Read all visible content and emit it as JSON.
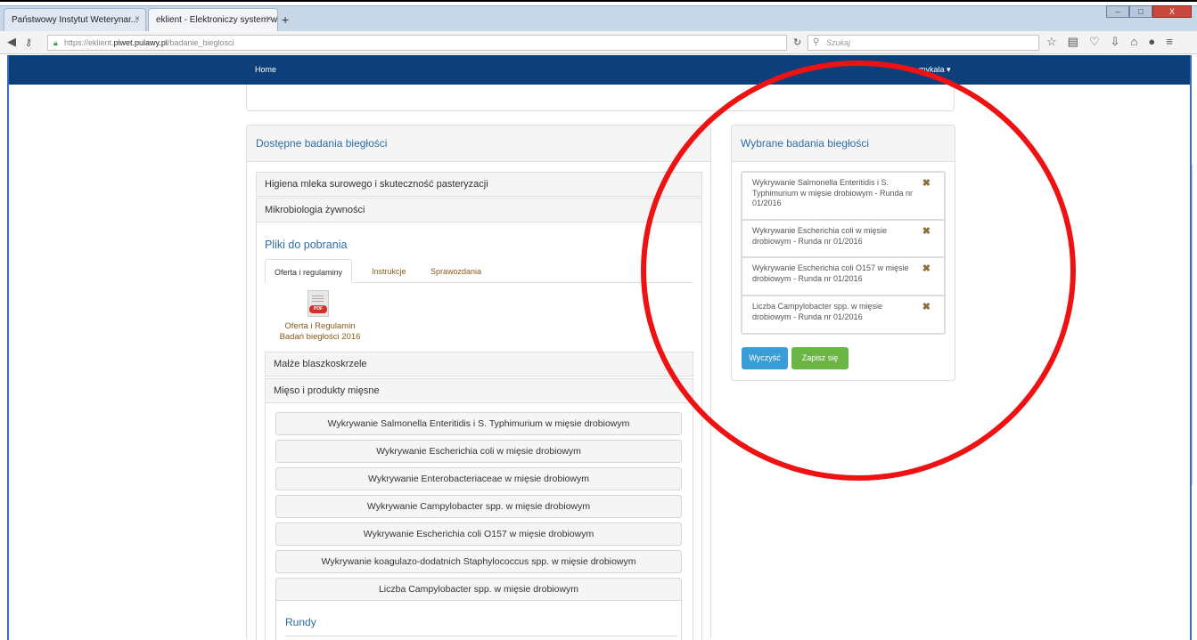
{
  "browser": {
    "tabs": [
      {
        "label": "Państwowy Instytut Weterynar..."
      },
      {
        "label": "eklient - Elektroniczy system w..."
      }
    ],
    "tab_close": "×",
    "new_tab": "+",
    "url_prefix": "https://eklient.",
    "url_domain": "piwet.pulawy.pl",
    "url_path": "/badanie_bieglosci",
    "search_placeholder": "Szukaj",
    "window_controls": {
      "minimize": "–",
      "maximize": "□",
      "close": "X"
    }
  },
  "appnav": {
    "home": "Home",
    "user": "…mykala ▾"
  },
  "left_panel": {
    "title": "Dostępne badania biegłości",
    "accordion": [
      {
        "label": "Higiena mleka surowego i skuteczność pasteryzacji"
      },
      {
        "label": "Mikrobiologia żywności"
      },
      {
        "label": "Małże blaszkoskrzele"
      },
      {
        "label": "Mięso i produkty mięsne"
      }
    ],
    "downloads_title": "Pliki do pobrania",
    "download_tabs": [
      {
        "label": "Oferta i regulaminy",
        "active": true
      },
      {
        "label": "Instrukcje"
      },
      {
        "label": "Sprawozdania"
      }
    ],
    "pdf_tag": "PDF",
    "pdf_label_1": "Oferta i Regulamin",
    "pdf_label_2": "Badań biegłości 2016",
    "items": [
      {
        "label": "Wykrywanie Salmonella Enteritidis i S. Typhimurium w mięsie drobiowym"
      },
      {
        "label": "Wykrywanie Escherichia coli w mięsie drobiowym"
      },
      {
        "label": "Wykrywanie Enterobacteriaceae w mięsie drobiowym"
      },
      {
        "label": "Wykrywanie Campylobacter spp. w mięsie drobiowym"
      },
      {
        "label": "Wykrywanie Escherichia coli O157 w mięsie drobiowym"
      },
      {
        "label": "Wykrywanie koagulazo-dodatnich Staphylococcus spp. w mięsie drobiowym"
      },
      {
        "label": "Liczba Campylobacter spp. w mięsie drobiowym"
      }
    ],
    "rundy": "Rundy"
  },
  "right_panel": {
    "title": "Wybrane badania biegłości",
    "selected": [
      {
        "label": "Wykrywanie Salmonella Enteritidis i S. Typhimurium w mięsie drobiowym - Runda nr 01/2016"
      },
      {
        "label": "Wykrywanie Escherichia coli w mięsie drobiowym - Runda nr 01/2016"
      },
      {
        "label": "Wykrywanie Escherichia coli O157 w mięsie drobiowym - Runda nr 01/2016"
      },
      {
        "label": "Liczba Campylobacter spp. w mięsie drobiowym - Runda nr 01/2016"
      }
    ],
    "remove_icon": "✖",
    "clear_button": "Wyczyść",
    "submit_button": "Zapisz się"
  },
  "colors": {
    "navbar": "#0d3f7a",
    "link": "#2e6da4",
    "annotation_ring": "#ee1212",
    "btn_blue": "#3a9dd6",
    "btn_green": "#6ab544"
  }
}
